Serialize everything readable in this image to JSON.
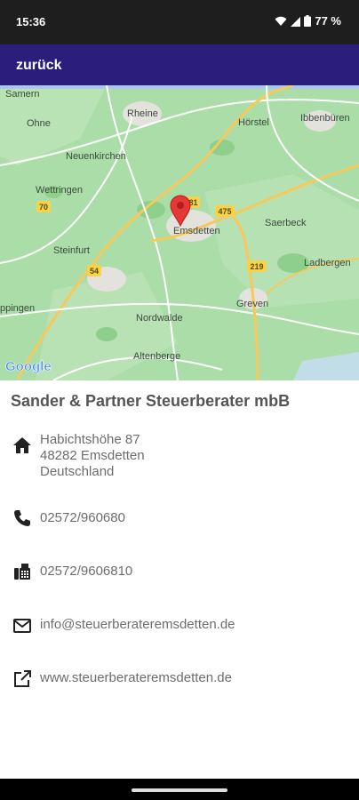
{
  "status_bar": {
    "time": "15:36",
    "battery_text": "77 %",
    "icons": [
      "wifi-icon",
      "signal-icon",
      "battery-icon"
    ]
  },
  "app_bar": {
    "back_label": "zurück",
    "background": "#2b1d7c"
  },
  "map": {
    "places": [
      "Samern",
      "Rheine",
      "Hörstel",
      "Ibbenbüren",
      "Ohne",
      "Neuenkirchen",
      "Wettringen",
      "Steinfurt",
      "Emsdetten",
      "Saerbeck",
      "Ladbergen",
      "Greven",
      "Nordwalde",
      "Altenberge",
      "ppingen"
    ],
    "road_numbers": [
      "70",
      "54",
      "475",
      "219",
      "481"
    ],
    "logo_text": "Google",
    "marker_color": "#e53935"
  },
  "company": {
    "name": "Sander & Partner Steuerberater mbB"
  },
  "contact": {
    "address_line1": "Habichtshöhe 87",
    "address_line2": "48282 Emsdetten",
    "address_line3": "Deutschland",
    "phone": "02572/960680",
    "fax": "02572/9606810",
    "email": "info@steuerberateremsdetten.de",
    "website": "www.steuerberateremsdetten.de"
  }
}
